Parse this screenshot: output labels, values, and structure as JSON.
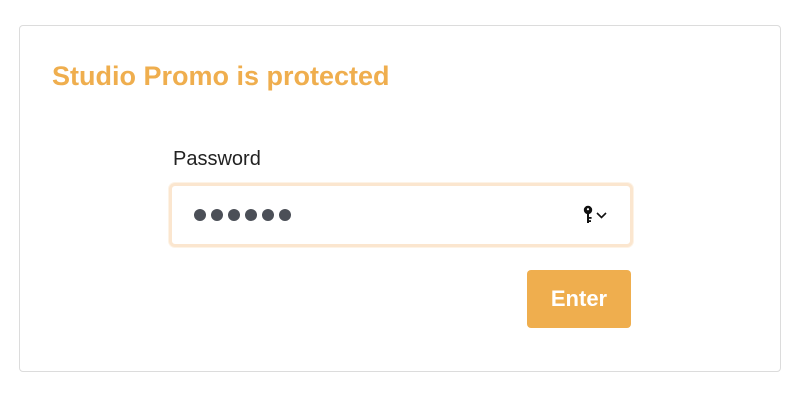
{
  "colors": {
    "accent": "#efae4e",
    "field_border": "#fbe6cf",
    "card_border": "#dcdcdc"
  },
  "card": {
    "title": "Studio Promo is protected"
  },
  "form": {
    "password_label": "Password",
    "password_value": "••••••",
    "password_length": 6,
    "key_icon": "key-icon",
    "dropdown_icon": "chevron-down-icon",
    "submit_label": "Enter"
  }
}
